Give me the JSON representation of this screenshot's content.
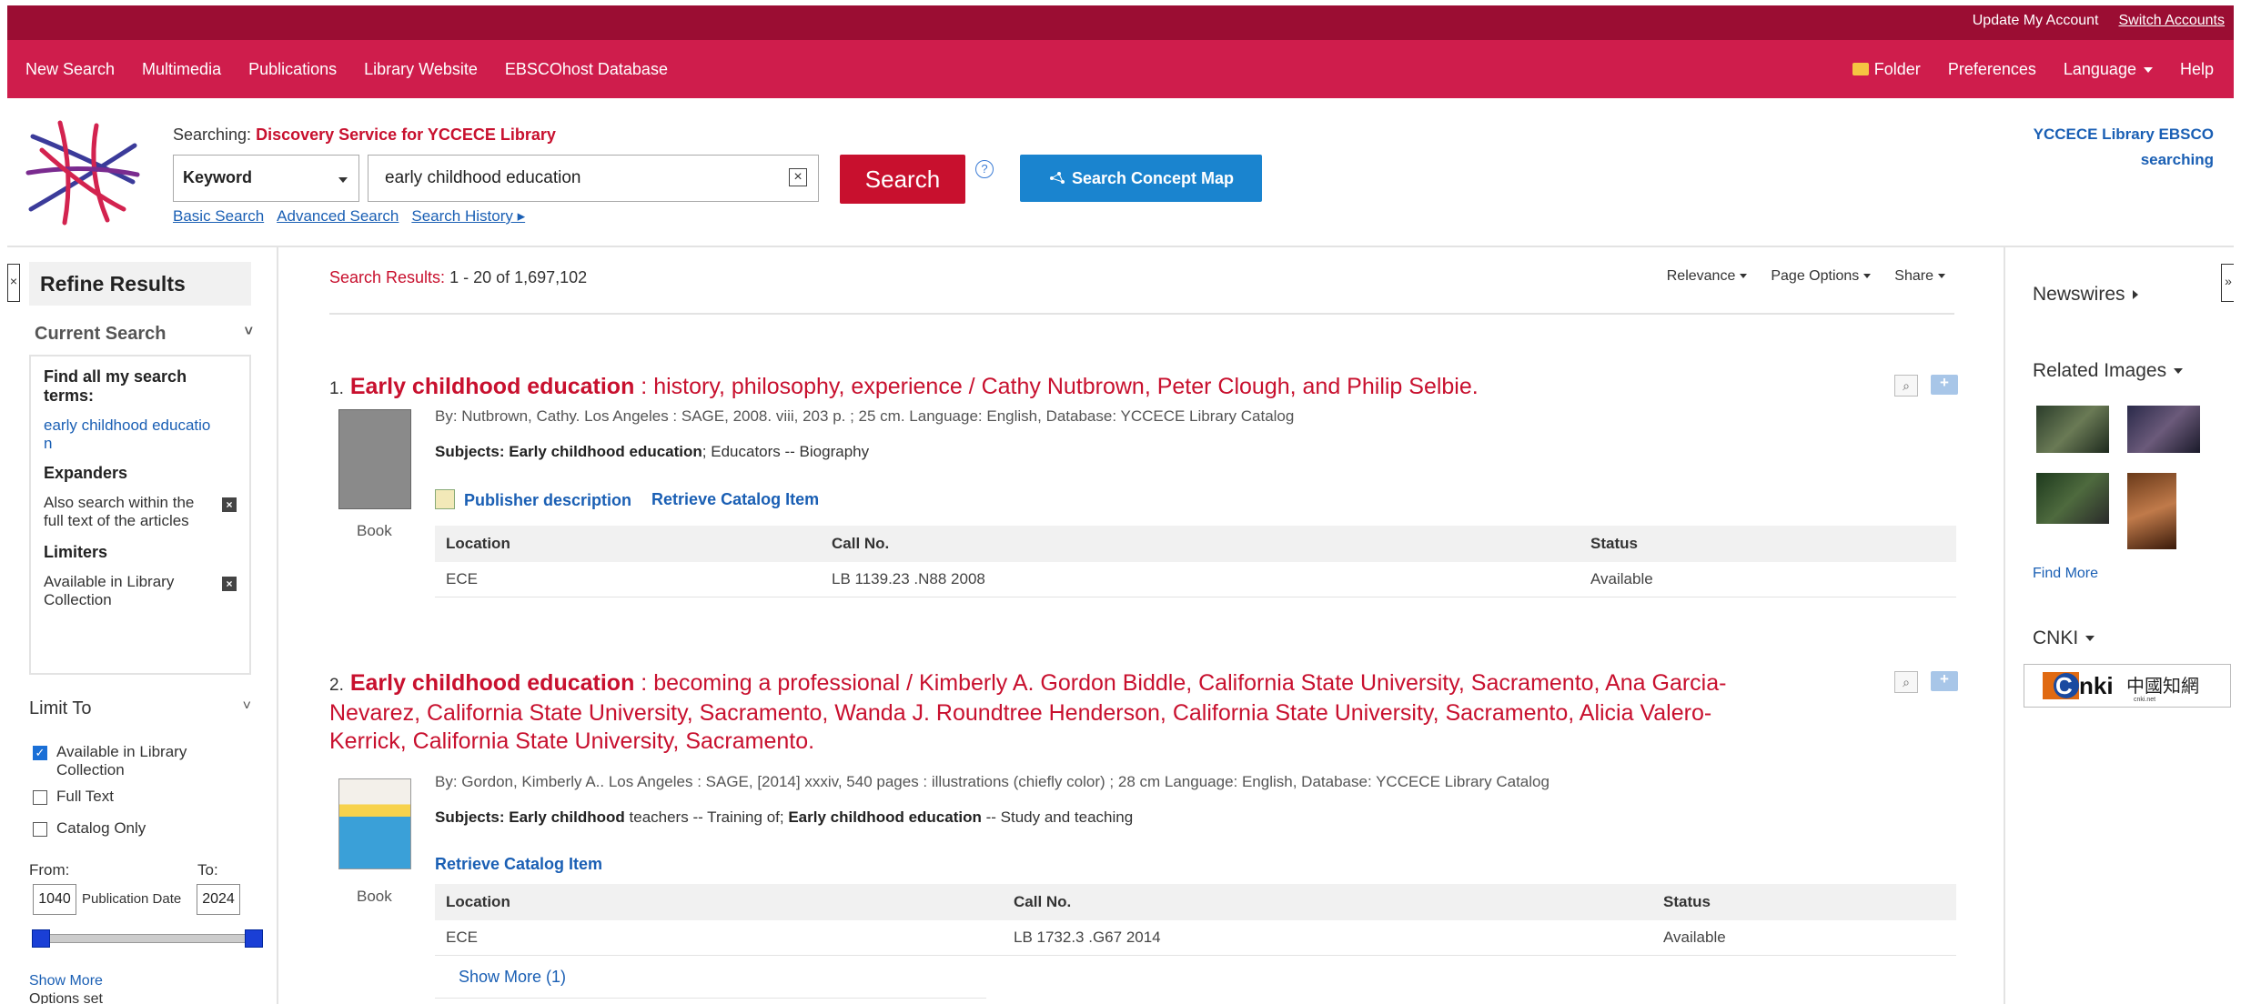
{
  "topbar": {
    "update_account": "Update My Account",
    "switch_accounts": "Switch Accounts"
  },
  "nav": {
    "left": [
      "New Search",
      "Multimedia",
      "Publications",
      "Library Website",
      "EBSCOhost Database"
    ],
    "folder": "Folder",
    "preferences": "Preferences",
    "language": "Language",
    "help": "Help"
  },
  "search": {
    "searching_prefix": "Searching:",
    "searching_target": "Discovery Service for YCCECE Library",
    "field": "Keyword",
    "query": "early childhood education",
    "search_button": "Search",
    "help": "?",
    "concept_map": "Search Concept Map",
    "basic": "Basic Search",
    "advanced": "Advanced Search",
    "history": "Search History ▸",
    "library_label": "YCCECE Library EBSCO searching"
  },
  "refine": {
    "title": "Refine Results",
    "current_search": "Current Search",
    "find_all": "Find all my search terms:",
    "term_line1": "early childhood educatio",
    "term_line2": "n",
    "expanders": "Expanders",
    "expander_1": "Also search within the full text of the articles",
    "limiters": "Limiters",
    "limiter_1": "Available in Library Collection",
    "limit_to": "Limit To",
    "cb_available": "Available in Library Collection",
    "cb_fulltext": "Full Text",
    "cb_catalog": "Catalog Only",
    "from": "From:",
    "to": "To:",
    "from_value": "1040",
    "to_value": "2024",
    "pub_date": "Publication Date",
    "show_more": "Show More",
    "options_set": "Options set"
  },
  "results": {
    "label": "Search Results:",
    "range": "1 - 20 of 1,697,102",
    "sort": "Relevance",
    "page_options": "Page Options",
    "share": "Share",
    "items": [
      {
        "num": "1.",
        "title_bold": "Early childhood education",
        "title_rest": " : history, philosophy, experience / Cathy Nutbrown, Peter Clough, and Philip Selbie.",
        "type": "Book",
        "meta": "By: Nutbrown, Cathy. Los Angeles : SAGE, 2008. viii, 203 p. ; 25 cm. Language: English, Database: YCCECE Library Catalog",
        "subjects_label": "Subjects:",
        "subjects_bold": "Early childhood education",
        "subjects_rest": "; Educators -- Biography",
        "action_1": "Publisher description",
        "action_2": "Retrieve Catalog Item",
        "headers": [
          "Location",
          "Call No.",
          "Status"
        ],
        "row": [
          "ECE",
          "LB 1139.23 .N88 2008",
          "Available"
        ]
      },
      {
        "num": "2.",
        "title_bold": "Early childhood education",
        "title_rest": " : becoming a professional / Kimberly A. Gordon Biddle, California State University, Sacramento, Ana Garcia-Nevarez, California State University, Sacramento, Wanda J. Roundtree Henderson, California State University, Sacramento, Alicia Valero-Kerrick, California State University, Sacramento.",
        "type": "Book",
        "meta": "By: Gordon, Kimberly A.. Los Angeles : SAGE, [2014] xxxiv, 540 pages : illustrations (chiefly color) ; 28 cm Language: English, Database: YCCECE Library Catalog",
        "subjects_label": "Subjects:",
        "subjects_bold1": "Early childhood",
        "subjects_mid": " teachers -- Training of; ",
        "subjects_bold2": "Early childhood education",
        "subjects_rest": " -- Study and teaching",
        "action_1": "Retrieve Catalog Item",
        "headers": [
          "Location",
          "Call No.",
          "Status"
        ],
        "row": [
          "ECE",
          "LB 1732.3 .G67 2014",
          "Available"
        ],
        "show_more": "Show More (1)"
      }
    ]
  },
  "right": {
    "newswires": "Newswires",
    "related_images": "Related Images",
    "find_more": "Find More",
    "cnki": "CNKI"
  },
  "colors": {
    "brand_dark": "#9b0d33",
    "brand": "#cf1d4c",
    "link": "#1a5fb4",
    "title": "#c8102e",
    "concept": "#1a84cf"
  }
}
